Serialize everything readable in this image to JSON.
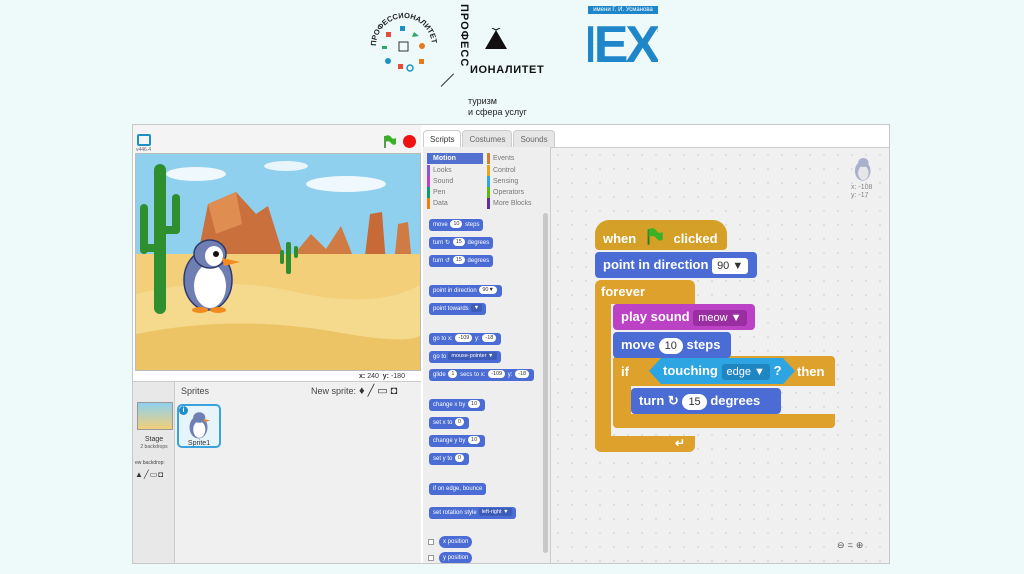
{
  "header": {
    "professionalitet": "ПРОФЕССИОНАЛИТЕТ",
    "prof_vertical": "ПРОФЕСС",
    "prof_horizontal": "ИОНАЛИТЕТ",
    "tagline_1": "туризм",
    "tagline_2": "и сфера услуг",
    "chesh_top": "имени Г. И. Усманова",
    "chesh_text": "ЧЕХТ"
  },
  "stage": {
    "version": "v446.4",
    "coords_x_label": "x:",
    "coords_x": "240",
    "coords_y_label": "y:",
    "coords_y": "-180"
  },
  "sprites": {
    "title": "Sprites",
    "new_sprite": "New sprite:",
    "stage_label": "Stage",
    "backdrops": "2 backdrops",
    "new_backdrop": "ew backdrop:",
    "sprite1": "Sprite1",
    "info": "i"
  },
  "tabs": [
    "Scripts",
    "Costumes",
    "Sounds"
  ],
  "categories": {
    "motion": "Motion",
    "looks": "Looks",
    "sound": "Sound",
    "pen": "Pen",
    "data": "Data",
    "events": "Events",
    "control": "Control",
    "sensing": "Sensing",
    "operators": "Operators",
    "more": "More Blocks"
  },
  "palette": {
    "move": "move",
    "move_val": "10",
    "steps": "steps",
    "turn": "turn",
    "turn_cw_val": "15",
    "degrees": "degrees",
    "turn_ccw_val": "15",
    "point_dir": "point in direction",
    "point_dir_val": "90▼",
    "point_towards": "point towards",
    "point_towards_val": "▼",
    "goto_xy": "go to x:",
    "goto_x": "-109",
    "goto_y_label": "y:",
    "goto_y": "-18",
    "goto": "go to",
    "goto_val": "mouse-pointer ▼",
    "glide": "glide",
    "glide_secs": "1",
    "glide_secs_to": "secs to x:",
    "glide_x": "-109",
    "glide_y_label": "y:",
    "glide_y": "-18",
    "change_x": "change x by",
    "change_x_val": "10",
    "set_x": "set x to",
    "set_x_val": "0",
    "change_y": "change y by",
    "change_y_val": "10",
    "set_y": "set y to",
    "set_y_val": "0",
    "bounce": "if on edge, bounce",
    "rotation": "set rotation style",
    "rotation_val": "left-right ▼",
    "x_position": "x position",
    "y_position": "y position"
  },
  "script": {
    "when": "when",
    "clicked": "clicked",
    "point_dir": "point in direction",
    "point_dir_val": "90 ▼",
    "forever": "forever",
    "play_sound": "play sound",
    "sound_val": "meow ▼",
    "move": "move",
    "move_val": "10",
    "steps": "steps",
    "if": "if",
    "touching": "touching",
    "touching_val": "edge ▼",
    "q": "?",
    "then": "then",
    "turn": "turn",
    "turn_val": "15",
    "degrees": "degrees"
  },
  "corner": {
    "x": "x: -108",
    "y": "y: -17"
  },
  "colors": {
    "motion": "#4a6cd4",
    "events": "#d5a028",
    "control": "#dda12c",
    "sound": "#bb42c4",
    "sensing": "#2ca5e2"
  },
  "icons": {
    "flag": "green-flag-icon",
    "stop": "stop-icon",
    "rotate_cw": "rotate-right-icon",
    "rotate_ccw": "rotate-left-icon"
  }
}
